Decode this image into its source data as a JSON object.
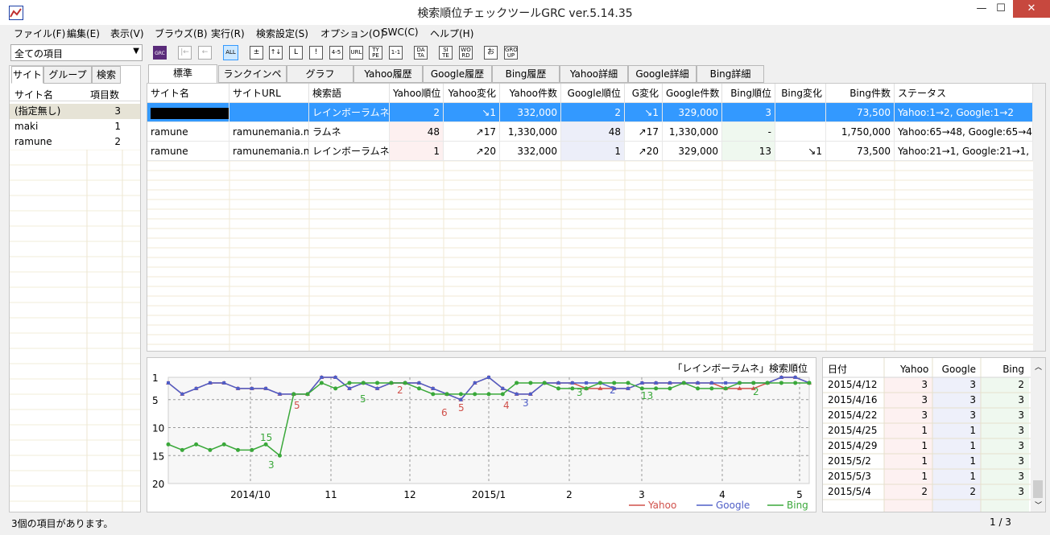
{
  "window": {
    "title": "検索順位チェックツールGRC ver.5.14.35",
    "minimize": "—",
    "maximize": "☐",
    "close": "✕"
  },
  "menu": [
    "ファイル(F)",
    "編集(E)",
    "表示(V)",
    "ブラウズ(B)",
    "実行(R)",
    "検索設定(S)",
    "オプション(O)",
    "SWC(C)",
    "ヘルプ(H)"
  ],
  "toolbar": {
    "combo_value": "全ての項目",
    "buttons": [
      "GRC",
      "|←",
      "←",
      "ALL",
      "±",
      "↑↓",
      "L",
      "!",
      "4-5",
      "URL",
      "TY PE",
      "1-1",
      "DA TA",
      "SI TE",
      "WO RD",
      "お",
      "GRO UP"
    ]
  },
  "left": {
    "tabs": [
      "サイト",
      "グループ",
      "検索"
    ],
    "headers": [
      "サイト名",
      "項目数"
    ],
    "rows": [
      {
        "name": "(指定無し)",
        "count": "3"
      },
      {
        "name": "maki",
        "count": "1"
      },
      {
        "name": "ramune",
        "count": "2"
      }
    ]
  },
  "main_tabs": [
    "標準",
    "ランクインページ",
    "グラフ",
    "Yahoo履歴",
    "Google履歴",
    "Bing履歴",
    "Yahoo詳細",
    "Google詳細",
    "Bing詳細"
  ],
  "grid": {
    "headers": [
      "サイト名",
      "サイトURL",
      "検索語",
      "Yahoo順位",
      "Yahoo変化",
      "Yahoo件数",
      "Google順位",
      "G変化",
      "Google件数",
      "Bing順位",
      "Bing変化",
      "Bing件数",
      "ステータス"
    ],
    "rows": [
      [
        "",
        "",
        "レインボーラムネ",
        "2",
        "↘1",
        "332,000",
        "2",
        "↘1",
        "329,000",
        "3",
        "",
        "73,500",
        "Yahoo:1→2, Google:1→2"
      ],
      [
        "ramune",
        "ramunemania.n",
        "ラムネ",
        "48",
        "↗17",
        "1,330,000",
        "48",
        "↗17",
        "1,330,000",
        "-",
        "",
        "1,750,000",
        "Yahoo:65→48, Google:65→4"
      ],
      [
        "ramune",
        "ramunemania.n",
        "レインボーラムネ",
        "1",
        "↗20",
        "332,000",
        "1",
        "↗20",
        "329,000",
        "13",
        "↘1",
        "73,500",
        "Yahoo:21→1, Google:21→1,"
      ]
    ]
  },
  "chart_data": {
    "type": "line",
    "title": "「レインボーラムネ」検索順位",
    "x_ticks": [
      "2014/10",
      "11",
      "12",
      "2015/1",
      "2",
      "3",
      "4",
      "5"
    ],
    "y_ticks": [
      "1",
      "5",
      "10",
      "15",
      "20"
    ],
    "ylim": [
      20,
      1
    ],
    "grid": true,
    "legend": "bottom-right",
    "series": [
      {
        "name": "Yahoo",
        "values": [
          2,
          4,
          3,
          2,
          2,
          3,
          3,
          3,
          4,
          4,
          4,
          1,
          1,
          3,
          2,
          3,
          2,
          2,
          2,
          3,
          4,
          5,
          2,
          1,
          3,
          4,
          4,
          2,
          2,
          2,
          3,
          3,
          3,
          3,
          2,
          2,
          2,
          2,
          2,
          2,
          3,
          3,
          3,
          2,
          1,
          1,
          2
        ]
      },
      {
        "name": "Google",
        "values": [
          2,
          4,
          3,
          2,
          2,
          3,
          3,
          3,
          4,
          4,
          4,
          1,
          1,
          3,
          2,
          3,
          2,
          2,
          2,
          3,
          4,
          5,
          2,
          1,
          3,
          4,
          4,
          2,
          2,
          2,
          2,
          2,
          3,
          3,
          2,
          2,
          2,
          2,
          2,
          2,
          2,
          2,
          2,
          2,
          1,
          1,
          2
        ]
      },
      {
        "name": "Bing",
        "values": [
          13,
          14,
          13,
          14,
          13,
          14,
          14,
          13,
          15,
          4,
          4,
          2,
          3,
          2,
          2,
          2,
          2,
          2,
          3,
          4,
          4,
          4,
          4,
          4,
          4,
          2,
          2,
          2,
          3,
          3,
          3,
          2,
          2,
          2,
          3,
          3,
          3,
          2,
          3,
          3,
          3,
          2,
          2,
          2,
          2,
          2,
          2
        ]
      }
    ],
    "annotations": [
      {
        "series": "Yahoo",
        "label": "5"
      },
      {
        "series": "Yahoo",
        "label": "2"
      },
      {
        "series": "Yahoo",
        "label": "6"
      },
      {
        "series": "Yahoo",
        "label": "5"
      },
      {
        "series": "Yahoo",
        "label": "4"
      },
      {
        "series": "Google",
        "label": "2"
      },
      {
        "series": "Google",
        "label": "3"
      },
      {
        "series": "Bing",
        "label": "13"
      },
      {
        "series": "Bing",
        "label": "15"
      },
      {
        "series": "Bing",
        "label": "3"
      },
      {
        "series": "Bing",
        "label": "5"
      },
      {
        "series": "Bing",
        "label": "3"
      },
      {
        "series": "Bing",
        "label": "2"
      }
    ],
    "colors": {
      "Yahoo": "#d0504a",
      "Google": "#4f5ec7",
      "Bing": "#3aa83a"
    }
  },
  "history": {
    "headers": [
      "日付",
      "Yahoo",
      "Google",
      "Bing"
    ],
    "rows": [
      [
        "2015/4/12",
        "3",
        "3",
        "2"
      ],
      [
        "2015/4/16",
        "3",
        "3",
        "3"
      ],
      [
        "2015/4/22",
        "3",
        "3",
        "3"
      ],
      [
        "2015/4/25",
        "1",
        "1",
        "3"
      ],
      [
        "2015/4/29",
        "1",
        "1",
        "3"
      ],
      [
        "2015/5/2",
        "1",
        "1",
        "3"
      ],
      [
        "2015/5/3",
        "1",
        "1",
        "3"
      ],
      [
        "2015/5/4",
        "2",
        "2",
        "3"
      ]
    ]
  },
  "status": {
    "left": "3個の項目があります。",
    "right": "1 / 3"
  }
}
